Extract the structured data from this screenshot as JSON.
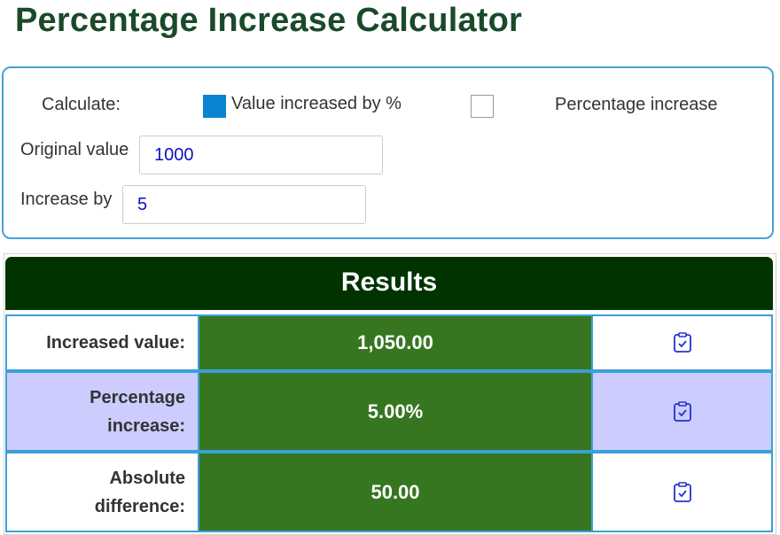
{
  "page": {
    "title": "Percentage Increase Calculator"
  },
  "calc": {
    "mode_label": "Calculate:",
    "option_value_increased": "Value increased by %",
    "option_value_increased_checked": true,
    "option_percentage_increase": "Percentage increase",
    "option_percentage_increase_checked": false,
    "original_label": "Original value",
    "original_value": "1000",
    "increase_label": "Increase by",
    "increase_value": "5"
  },
  "results": {
    "header": "Results",
    "rows": [
      {
        "label": "Increased value:",
        "value": "1,050.00"
      },
      {
        "label": "Percentage increase:",
        "value": "5.00%"
      },
      {
        "label": "Absolute difference:",
        "value": "50.00"
      }
    ]
  },
  "colors": {
    "title": "#1a4a2a",
    "accent_border": "#4a9fd8",
    "checkbox_checked": "#0a84d0",
    "results_header": "#003300",
    "value_cell": "#377621",
    "alt_row": "#ccccff",
    "input_text": "#1010c0"
  },
  "icons": {
    "copy": "clipboard-check-icon"
  }
}
